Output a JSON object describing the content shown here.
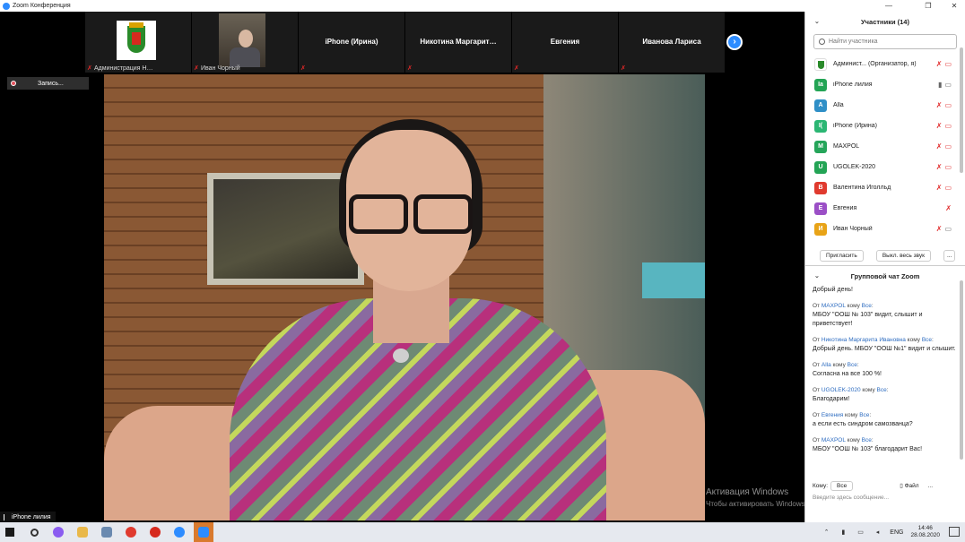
{
  "window": {
    "title": "Zoom Конференция",
    "minimize": "—",
    "maximize": "❐",
    "close": "✕"
  },
  "strip": {
    "tiles": [
      {
        "name": "",
        "label": "Администрация Н…"
      },
      {
        "name": "",
        "label": "Иван Чорный"
      },
      {
        "name": "iPhone (Ирина)",
        "label": ""
      },
      {
        "name": "Никотина  Маргарит…",
        "label": ""
      },
      {
        "name": "Евгения",
        "label": ""
      },
      {
        "name": "Иванова Лариса",
        "label": ""
      }
    ],
    "next": "›"
  },
  "record": {
    "label": "Запись..."
  },
  "watermark": {
    "line1": "Активация Windows",
    "line2": "Чтобы активировать Windows, перейдите в раздел \"Параметры\"."
  },
  "self_label": "iPhone лилия",
  "participants": {
    "header": "Участники (14)",
    "search_placeholder": "Найти участника",
    "list": [
      {
        "initial": "",
        "name": "Админист... (Организатор, я)",
        "color": "#ffffff"
      },
      {
        "initial": "Ia",
        "name": "iPhone лилия",
        "color": "#23a455"
      },
      {
        "initial": "A",
        "name": "Alla",
        "color": "#2f8fc7"
      },
      {
        "initial": "I(",
        "name": "iPhone (Ирина)",
        "color": "#2bb673"
      },
      {
        "initial": "M",
        "name": "MAXPOL",
        "color": "#25a55a"
      },
      {
        "initial": "U",
        "name": "UGOLEK-2020",
        "color": "#23a455"
      },
      {
        "initial": "В",
        "name": "Валентина Иголльд",
        "color": "#e03a2e"
      },
      {
        "initial": "Е",
        "name": "Евгения",
        "color": "#9b4fc6"
      },
      {
        "initial": "И",
        "name": "Иван Чорный",
        "color": "#e8a317"
      }
    ],
    "invite": "Пригласить",
    "mute_all": "Выкл. весь звук",
    "more": "..."
  },
  "chat": {
    "header": "Групповой чат Zoom",
    "messages": [
      {
        "from": "",
        "to": "",
        "text": "Добрый день!"
      },
      {
        "from": "MAXPOL",
        "to": "Все",
        "text": "МБОУ \"ООШ № 103\" видит, слышит и приветствует!"
      },
      {
        "from": "Никотина Маргарита Ивановна",
        "to": "Все",
        "text": "Добрый день. МБОУ \"ООШ №1\" видит и слышит."
      },
      {
        "from": "Alla",
        "to": "Все",
        "text": "Согласна на все 100 %!"
      },
      {
        "from": "UGOLEK-2020",
        "to": "Все",
        "text": "Благодарим!"
      },
      {
        "from": "Евгения ",
        "to": "Все",
        "text": "а если есть синдром самозванца?"
      },
      {
        "from": "MAXPOL",
        "to": "Все",
        "text": "МБОУ \"ООШ № 103\" благодарит Вас!"
      }
    ],
    "from_word": "От",
    "to_word": "кому",
    "to_label": "Кому:",
    "to_value": "Все",
    "file": "Файл",
    "more": "...",
    "input_placeholder": "Введите здесь сообщение..."
  },
  "taskbar": {
    "lang": "ENG",
    "time": "14:46",
    "date": "28.08.2020"
  }
}
